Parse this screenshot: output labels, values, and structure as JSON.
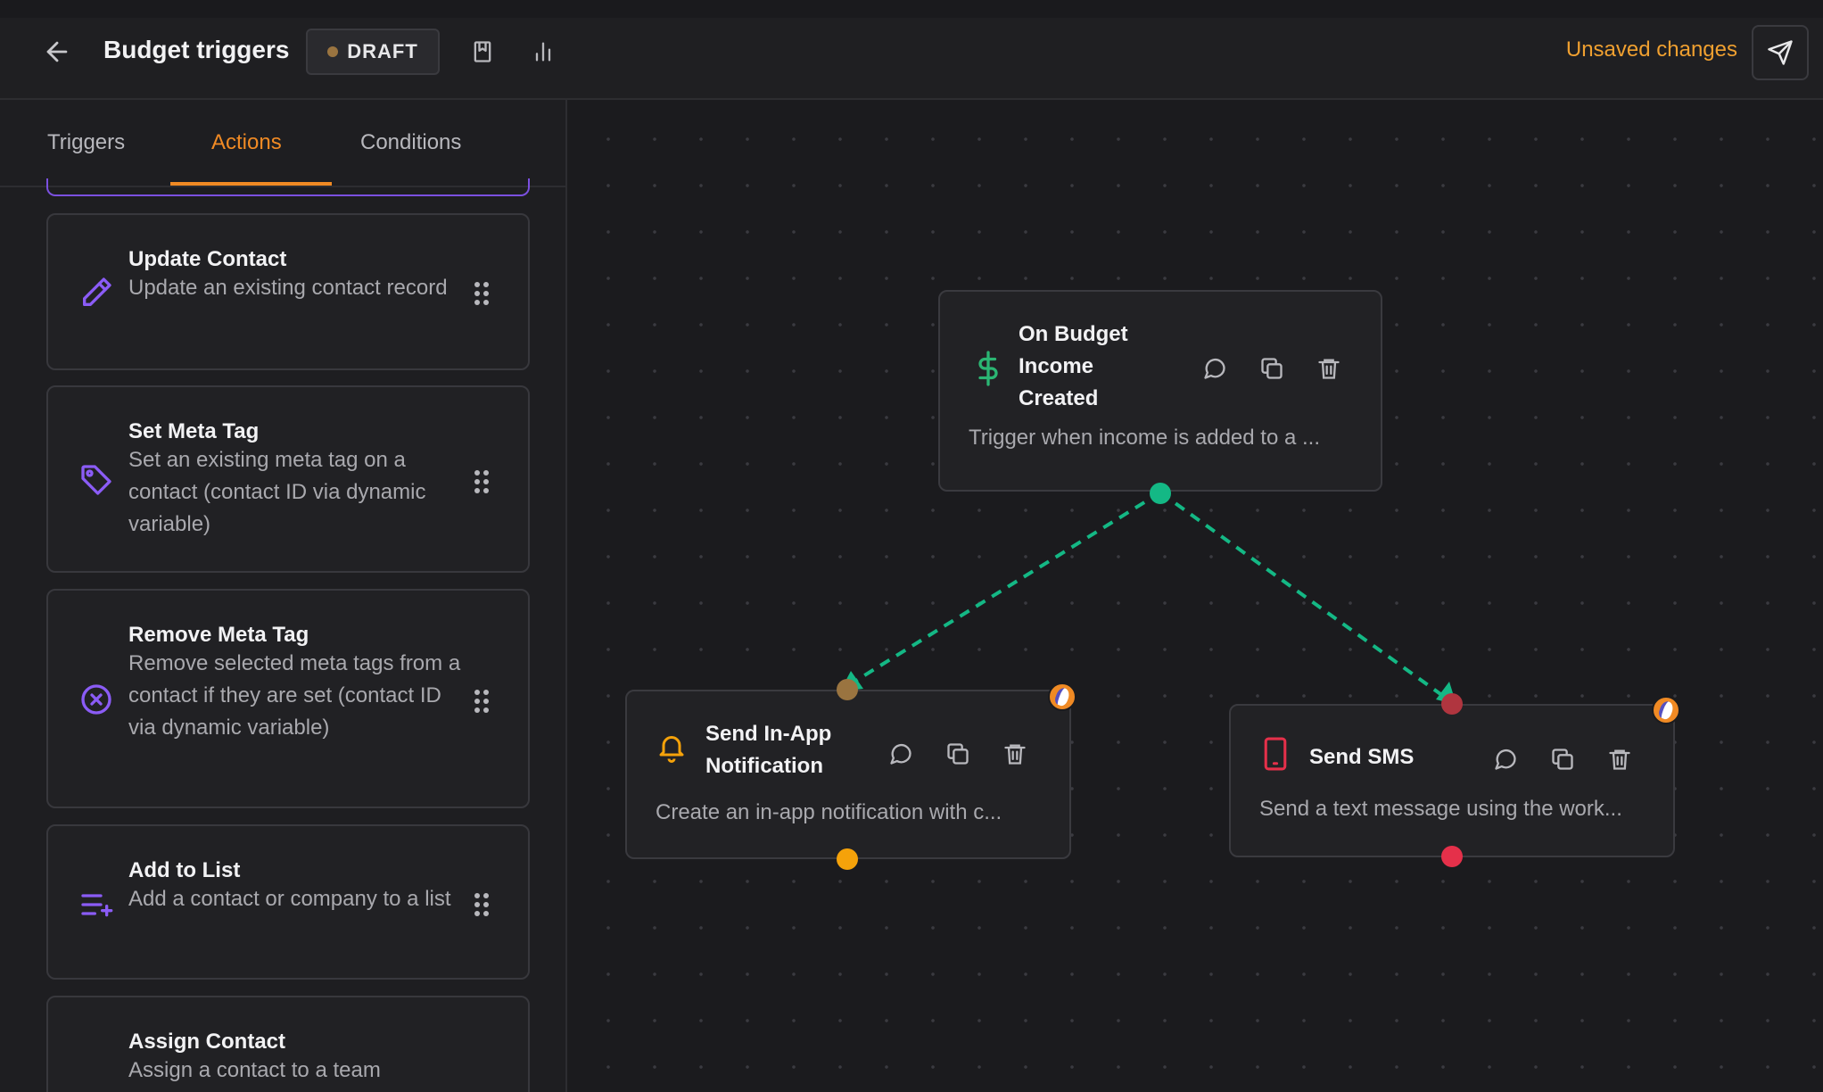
{
  "header": {
    "title": "Budget triggers",
    "status_badge": "DRAFT",
    "unsaved_text": "Unsaved changes"
  },
  "sidebar": {
    "tabs": [
      {
        "label": "Triggers"
      },
      {
        "label": "Actions"
      },
      {
        "label": "Conditions"
      }
    ],
    "active_tab": "Actions",
    "items": [
      {
        "title": "Update Contact",
        "desc": "Update an existing contact record",
        "icon": "pencil-icon"
      },
      {
        "title": "Set Meta Tag",
        "desc": "Set an existing meta tag on a contact (contact ID via dynamic variable)",
        "icon": "tag-icon"
      },
      {
        "title": "Remove Meta Tag",
        "desc": "Remove selected meta tags from a contact if they are set (contact ID via dynamic variable)",
        "icon": "x-circle-icon"
      },
      {
        "title": "Add to List",
        "desc": "Add a contact or company to a list",
        "icon": "list-add-icon"
      },
      {
        "title": "Assign Contact",
        "desc": "Assign a contact to a team",
        "icon": "user-assign-icon"
      }
    ]
  },
  "canvas": {
    "nodes": [
      {
        "title": "On Budget Income Created",
        "desc": "Trigger when income is added to a ...",
        "icon": "dollar-icon",
        "color": "#2bb673"
      },
      {
        "title": "Send In-App Notification",
        "desc": "Create an in-app notification with c...",
        "icon": "bell-icon",
        "color": "#f5a20a"
      },
      {
        "title": "Send SMS",
        "desc": "Send a text message using the work...",
        "icon": "phone-icon",
        "color": "#e5304a"
      }
    ]
  },
  "colors": {
    "accent": "#f08a24",
    "purple": "#8b5cf6",
    "edge": "#14b885"
  }
}
